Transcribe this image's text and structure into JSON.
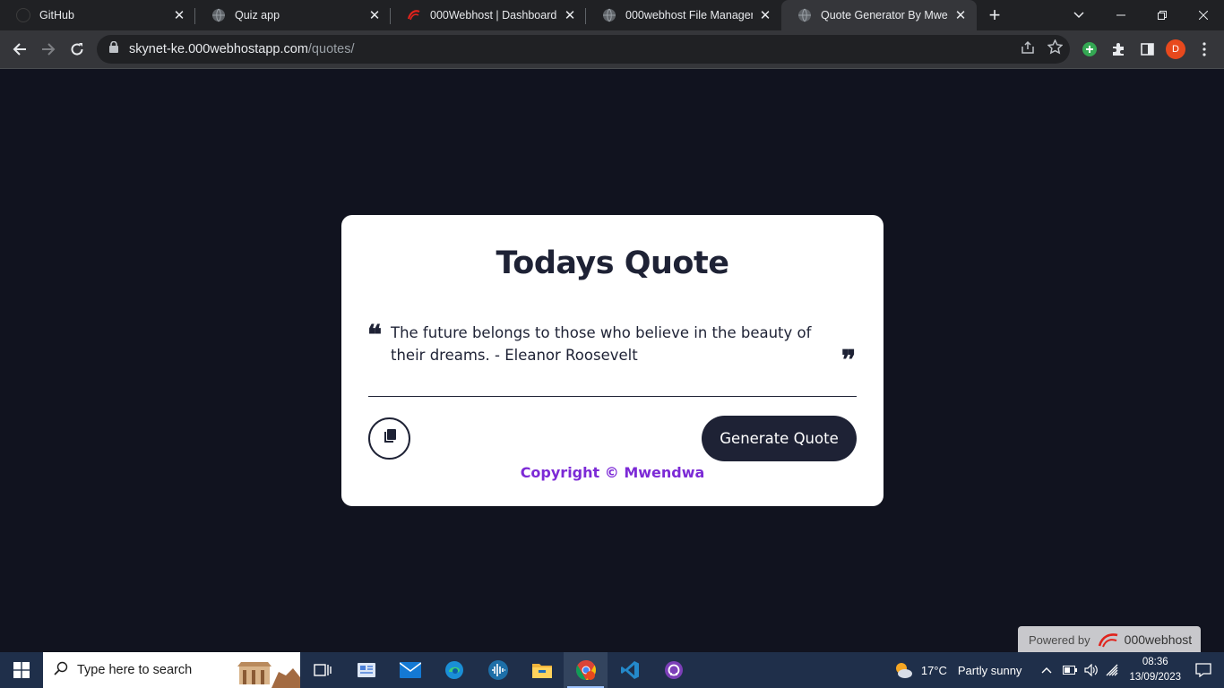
{
  "browser": {
    "tabs": [
      {
        "title": "GitHub",
        "icon": "github-icon",
        "active": false
      },
      {
        "title": "Quiz app",
        "icon": "globe-icon",
        "active": false
      },
      {
        "title": "000Webhost | Dashboard",
        "icon": "webhost-icon",
        "active": false
      },
      {
        "title": "000webhost File Manager",
        "icon": "globe-icon",
        "active": false
      },
      {
        "title": "Quote Generator By Mwendwa",
        "icon": "globe-icon",
        "active": true
      }
    ],
    "url_host": "skynet-ke.000webhostapp.com",
    "url_path": "/quotes/",
    "profile_initial": "D"
  },
  "card": {
    "title": "Todays Quote",
    "quote": "The future belongs to those who believe in the beauty of their dreams. - Eleanor Roosevelt",
    "generate_label": "Generate Quote",
    "copyright": "Copyright © Mwendwa"
  },
  "powered": {
    "label": "Powered by",
    "brand": "000webhost"
  },
  "taskbar": {
    "search_placeholder": "Type here to search",
    "weather_temp": "17°C",
    "weather_text": "Partly sunny",
    "time": "08:36",
    "date": "13/09/2023"
  },
  "colors": {
    "page_bg": "#11131f",
    "card_text": "#1e2235",
    "copyright": "#7c2ad6"
  }
}
